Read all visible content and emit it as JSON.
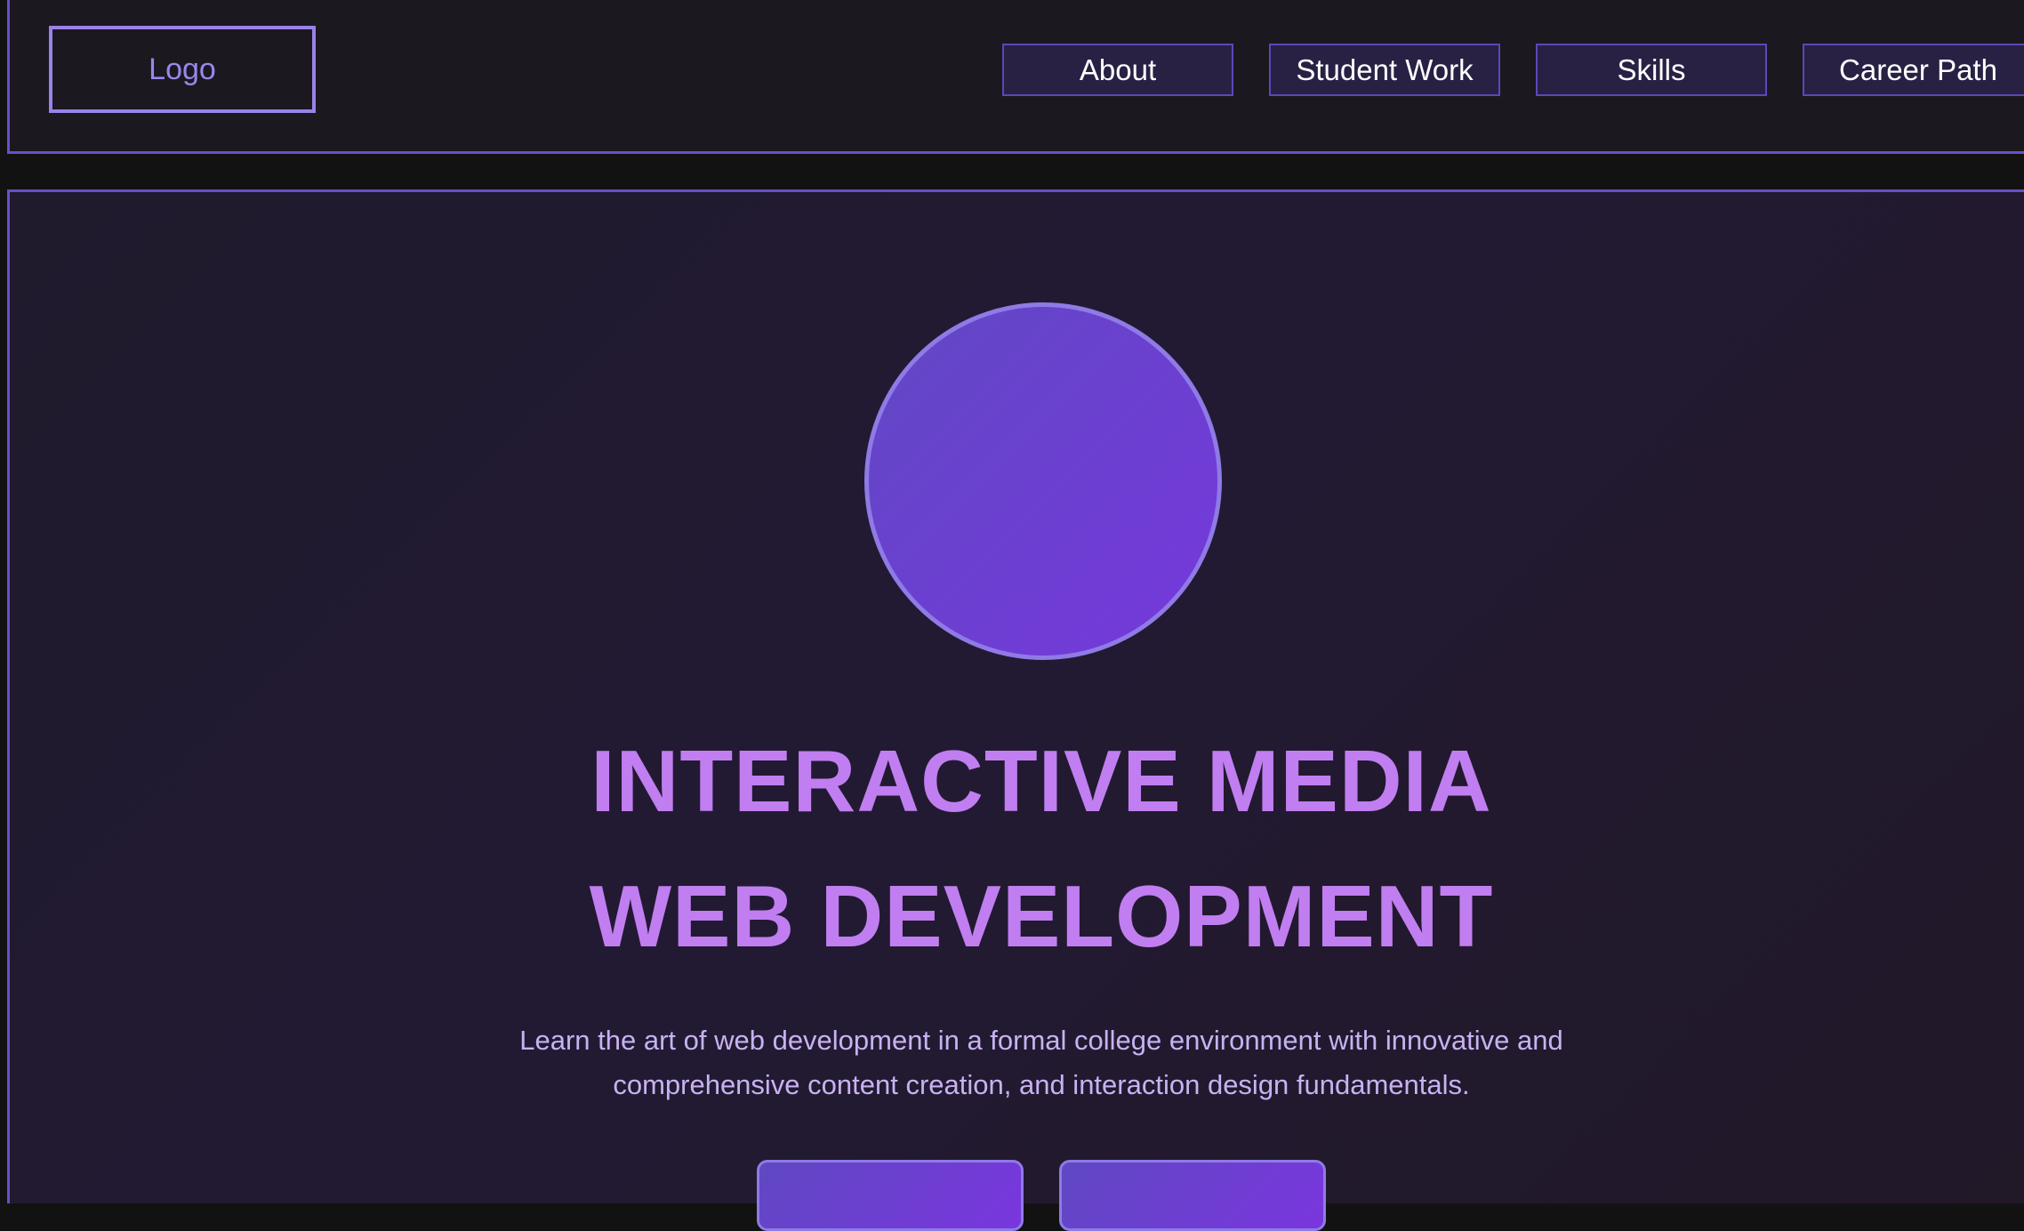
{
  "header": {
    "logo_label": "Logo",
    "nav": [
      {
        "label": "About"
      },
      {
        "label": "Student Work"
      },
      {
        "label": "Skills"
      },
      {
        "label": "Career Path"
      }
    ]
  },
  "hero": {
    "title_line1": "INTERACTIVE MEDIA",
    "title_line2": "WEB DEVELOPMENT",
    "subtitle": "Learn the art of web development in a formal college environment with innovative and comprehensive content creation, and interaction design fundamentals."
  },
  "colors": {
    "accent": "#6a4fc9",
    "headline": "#c17ef0",
    "subtitle": "#c7b2f2",
    "nav_background": "#282144"
  }
}
